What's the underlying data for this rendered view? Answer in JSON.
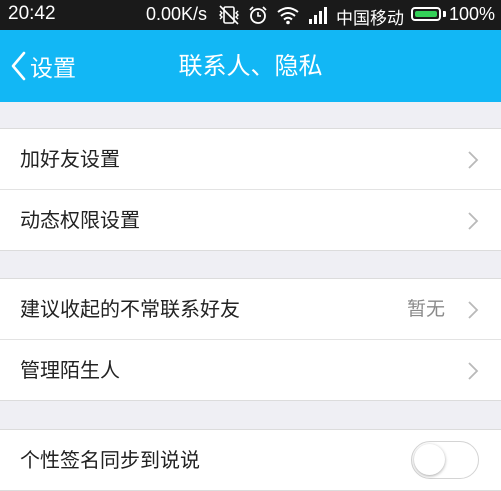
{
  "status_bar": {
    "time": "20:42",
    "network_speed": "0.00K/s",
    "carrier": "中国移动",
    "battery_percent": "100%",
    "icons": [
      "vibrate-off-icon",
      "alarm-icon",
      "wifi-icon",
      "signal-icon",
      "battery-icon"
    ]
  },
  "header": {
    "back_label": "设置",
    "title": "联系人、隐私",
    "background_color": "#12b7f5"
  },
  "groups": [
    {
      "rows": [
        {
          "label": "加好友设置"
        },
        {
          "label": "动态权限设置"
        }
      ]
    },
    {
      "rows": [
        {
          "label": "建议收起的不常联系好友",
          "value": "暂无"
        },
        {
          "label": "管理陌生人"
        }
      ]
    },
    {
      "rows": [
        {
          "label": "个性签名同步到说说",
          "toggle_on": false
        }
      ]
    }
  ]
}
